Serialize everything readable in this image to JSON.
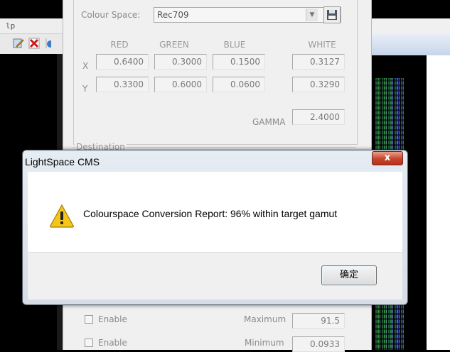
{
  "background": {
    "menu_text": "lp",
    "toolbar_icons": [
      "edit-icon",
      "delete-icon"
    ]
  },
  "panel": {
    "colour_space_label": "Colour Space:",
    "colour_space_value": "Rec709",
    "headers": [
      "RED",
      "GREEN",
      "BLUE",
      "WHITE"
    ],
    "row_x_label": "X",
    "row_y_label": "Y",
    "x_values": [
      "0.6400",
      "0.3000",
      "0.1500",
      "0.3127"
    ],
    "y_values": [
      "0.3300",
      "0.6000",
      "0.0600",
      "0.3290"
    ],
    "gamma_label": "GAMMA",
    "gamma_value": "2.4000",
    "destination_label": "Destination",
    "enable_label_1": "Enable",
    "enable_label_2": "Enable",
    "maximum_label": "Maximum",
    "maximum_value": "91.5",
    "minimum_label": "Minimum",
    "minimum_value": "0.0933"
  },
  "dialog": {
    "title": "LightSpace CMS",
    "message": "Colourspace Conversion Report: 96% within target gamut",
    "ok_label": "确定",
    "close_glyph": "x"
  },
  "colors": {
    "close_button": "#c8432b",
    "warning_icon": "#f5c518"
  }
}
